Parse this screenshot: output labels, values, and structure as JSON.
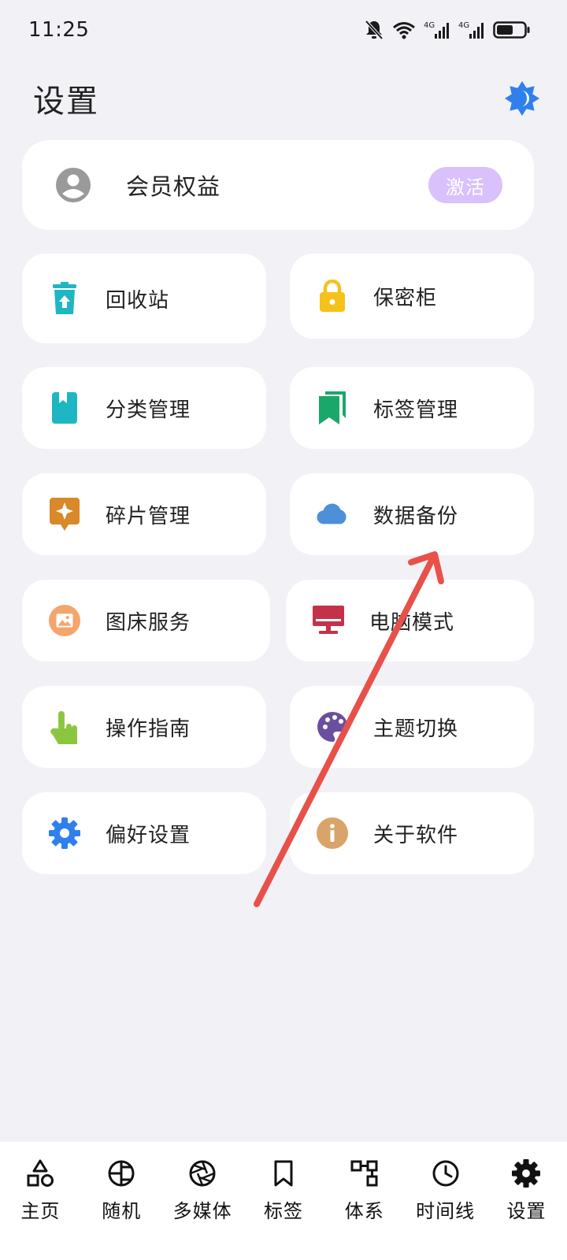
{
  "status_bar": {
    "time": "11:25",
    "network_label_1": "4G",
    "network_label_2": "4G"
  },
  "header": {
    "title": "设置"
  },
  "member": {
    "label": "会员权益",
    "action": "激活"
  },
  "grid": {
    "recycle": "回收站",
    "vault": "保密柜",
    "category": "分类管理",
    "tags": "标签管理",
    "fragments": "碎片管理",
    "backup": "数据备份",
    "image_host": "图床服务",
    "desktop": "电脑模式",
    "guide": "操作指南",
    "theme": "主题切换",
    "prefs": "偏好设置",
    "about": "关于软件"
  },
  "nav": {
    "home": "主页",
    "random": "随机",
    "media": "多媒体",
    "tags": "标签",
    "system": "体系",
    "timeline": "时间线",
    "settings": "设置"
  },
  "colors": {
    "background": "#f1f1f6",
    "card": "#ffffff",
    "activate": "#d9c1fb",
    "accent_blue": "#2f80ed",
    "recycle_teal": "#1fb6c4",
    "lock_yellow": "#f5c21b",
    "bookmark_green": "#1aa86a",
    "shard_orange": "#d9882a",
    "cloud_blue": "#4d8fd9",
    "image_orange": "#f5a56b",
    "desktop_red": "#c4324a",
    "hand_green": "#8cc63f",
    "palette_purple": "#6a4fa0",
    "info_tan": "#d8a46a",
    "annotation_arrow": "#e8504a"
  },
  "icons": {
    "theme": "theme-brightness-icon",
    "member": "account-circle-icon",
    "recycle": "recycle-bin-icon",
    "vault": "lock-icon",
    "category": "book-icon",
    "tags": "bookmarks-icon",
    "fragments": "sparkle-badge-icon",
    "backup": "cloud-icon",
    "image_host": "image-icon",
    "desktop": "monitor-icon",
    "guide": "touch-hand-icon",
    "theme_switch": "palette-icon",
    "prefs": "gear-icon",
    "about": "info-icon"
  }
}
